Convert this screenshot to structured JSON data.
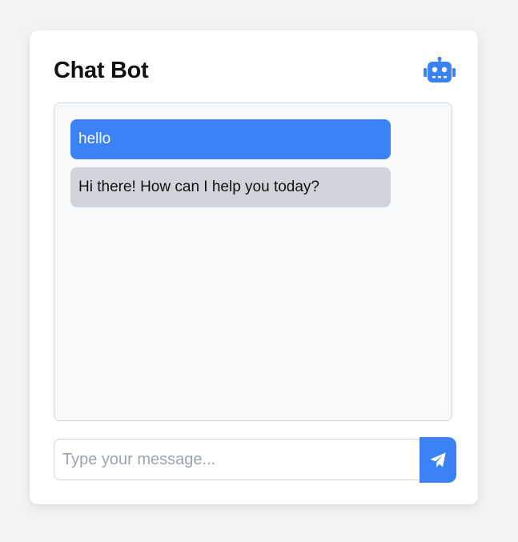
{
  "header": {
    "title": "Chat Bot",
    "icon": "robot-icon"
  },
  "messages": [
    {
      "role": "user",
      "text": "hello"
    },
    {
      "role": "bot",
      "text": "Hi there! How can I help you today?"
    }
  ],
  "composer": {
    "placeholder": "Type your message...",
    "value": "",
    "send_icon": "paper-plane-icon"
  },
  "colors": {
    "accent": "#3b82f6",
    "bot_bubble": "#d1d5db",
    "background": "#f2f3f5"
  }
}
